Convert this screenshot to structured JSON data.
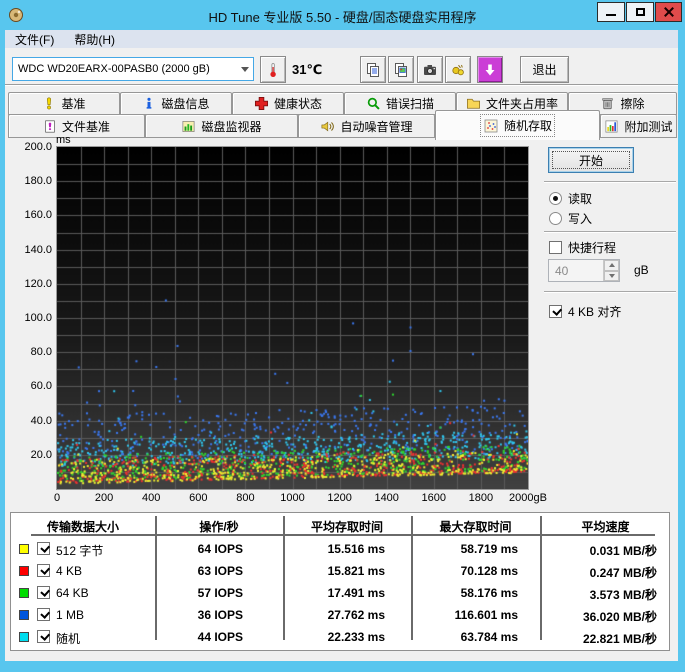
{
  "window": {
    "title": "HD Tune 专业版 5.50 - 硬盘/固态硬盘实用程序"
  },
  "menu": {
    "items": [
      {
        "label": "文件(F)"
      },
      {
        "label": "帮助(H)"
      }
    ]
  },
  "toolbar": {
    "drive_select": "WDC WD20EARX-00PASB0 (2000 gB)",
    "temperature": "31℃",
    "exit_label": "退出",
    "icons": [
      "thermometer",
      "copy-text",
      "copy-image",
      "camera",
      "export",
      "update-arrow"
    ]
  },
  "tabs": {
    "active": "随机存取",
    "row1": [
      {
        "label": "基准",
        "icon": "exclamation"
      },
      {
        "label": "磁盘信息",
        "icon": "info"
      },
      {
        "label": "健康状态",
        "icon": "health-cross"
      },
      {
        "label": "错误扫描",
        "icon": "magnifier"
      },
      {
        "label": "文件夹占用率",
        "icon": "folder"
      },
      {
        "label": "擦除",
        "icon": "trash"
      }
    ],
    "row2": [
      {
        "label": "文件基准",
        "icon": "file-benchmark"
      },
      {
        "label": "磁盘监视器",
        "icon": "disk-monitor"
      },
      {
        "label": "自动噪音管理",
        "icon": "speaker"
      },
      {
        "label": "随机存取",
        "icon": "scatter-dots"
      },
      {
        "label": "附加测试",
        "icon": "extra-tests"
      }
    ]
  },
  "controls": {
    "start_label": "开始",
    "read_label": "读取",
    "read_selected": true,
    "write_label": "写入",
    "write_selected": false,
    "short_stroke_label": "快捷行程",
    "short_stroke_checked": false,
    "short_stroke_value": "40",
    "short_stroke_unit": "gB",
    "align_label": "4 KB 对齐",
    "align_checked": true
  },
  "chart_data": {
    "type": "scatter",
    "ylabel": "ms",
    "ylim": [
      0,
      200
    ],
    "ytick_step": 20,
    "grid_step_y": 10,
    "xlim": [
      0,
      2000
    ],
    "xtick_step": 200,
    "grid_step_x": 100,
    "x_unit": "gB",
    "grid": true,
    "background": {
      "top": "#000000",
      "bottom": "#414141",
      "grid_color": "#5a5a5a"
    },
    "series": [
      {
        "name": "1 MB",
        "color": "#3b78f0",
        "seed": 11,
        "count": 430,
        "base0": 16,
        "base1": 21,
        "spread": 28,
        "pow": 1.0,
        "tail_frac": 0.055,
        "tail_max": 78,
        "rare_frac": 0.006,
        "rare_max": 116,
        "iops": 36,
        "avg_ms": 27.762,
        "max_ms": 116.601,
        "avg_speed_mb_s": 36.02
      },
      {
        "name": "随机",
        "color": "#2fc8f0",
        "seed": 22,
        "count": 480,
        "base0": 12.5,
        "base1": 18,
        "spread": 16,
        "pow": 1.15,
        "tail_frac": 0.035,
        "tail_max": 52,
        "rare_frac": 0.003,
        "rare_max": 64,
        "iops": 44,
        "avg_ms": 22.233,
        "max_ms": 63.784,
        "avg_speed_mb_s": 22.821
      },
      {
        "name": "64 KB",
        "color": "#2ed82e",
        "seed": 33,
        "count": 520,
        "base0": 4.5,
        "base1": 11,
        "spread": 15,
        "pow": 1.35,
        "tail_frac": 0.022,
        "tail_max": 45,
        "rare_frac": 0.002,
        "rare_max": 58,
        "iops": 57,
        "avg_ms": 17.491,
        "max_ms": 58.176,
        "avg_speed_mb_s": 3.573
      },
      {
        "name": "4 KB",
        "color": "#f03030",
        "seed": 44,
        "count": 520,
        "base0": 3.2,
        "base1": 10,
        "spread": 14,
        "pow": 1.5,
        "tail_frac": 0.02,
        "tail_max": 42,
        "rare_frac": 0.002,
        "rare_max": 70,
        "iops": 63,
        "avg_ms": 15.821,
        "max_ms": 70.128,
        "avg_speed_mb_s": 0.247
      },
      {
        "name": "512 字节",
        "color": "#f0f030",
        "seed": 55,
        "count": 520,
        "base0": 3.0,
        "base1": 9.5,
        "spread": 13,
        "pow": 1.5,
        "tail_frac": 0.02,
        "tail_max": 40,
        "rare_frac": 0.002,
        "rare_max": 58,
        "iops": 64,
        "avg_ms": 15.516,
        "max_ms": 58.719,
        "avg_speed_mb_s": 0.031
      }
    ]
  },
  "table": {
    "headers": [
      "传输数据大小",
      "操作/秒",
      "平均存取时间",
      "最大存取时间",
      "平均速度"
    ],
    "rows": [
      {
        "color": "#ffff00",
        "checked": true,
        "label": "512 字节",
        "iops": "64 IOPS",
        "avg": "15.516 ms",
        "max": "58.719 ms",
        "speed": "0.031 MB/秒"
      },
      {
        "color": "#ff0000",
        "checked": true,
        "label": "4 KB",
        "iops": "63 IOPS",
        "avg": "15.821 ms",
        "max": "70.128 ms",
        "speed": "0.247 MB/秒"
      },
      {
        "color": "#00dd00",
        "checked": true,
        "label": "64 KB",
        "iops": "57 IOPS",
        "avg": "17.491 ms",
        "max": "58.176 ms",
        "speed": "3.573 MB/秒"
      },
      {
        "color": "#0055dd",
        "checked": true,
        "label": "1 MB",
        "iops": "36 IOPS",
        "avg": "27.762 ms",
        "max": "116.601 ms",
        "speed": "36.020 MB/秒"
      },
      {
        "color": "#00ddee",
        "checked": true,
        "label": "随机",
        "iops": "44 IOPS",
        "avg": "22.233 ms",
        "max": "63.784 ms",
        "speed": "22.821 MB/秒"
      }
    ]
  }
}
